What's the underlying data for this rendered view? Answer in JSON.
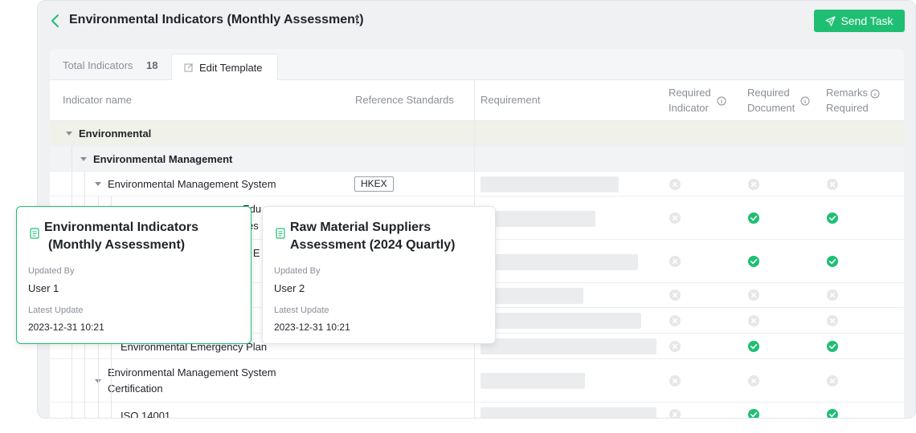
{
  "header": {
    "title": "Environmental Indicators (Monthly Assessment)",
    "send_label": "Send Task"
  },
  "toolbar": {
    "total_label": "Total Indicators",
    "total_count": "18",
    "edit_label": "Edit Template"
  },
  "table": {
    "columns": {
      "name": "Indicator name",
      "standards": "Reference Standards",
      "requirement": "Requirement",
      "req_indicator_1": "Required",
      "req_indicator_2": "Indicator",
      "req_document_1": "Required",
      "req_document_2": "Document",
      "remarks_1": "Remarks",
      "remarks_2": "Required"
    },
    "rows": [
      {
        "name": "Environmental"
      },
      {
        "name": "Environmental Management"
      },
      {
        "name": "Environmental Management System",
        "standard": "HKEX"
      },
      {
        "name": "Environmental Emergency Plan"
      },
      {
        "name_1": "Environmental Management System",
        "name_2": "Certification"
      },
      {
        "name": "ISO 14001"
      }
    ],
    "partial": {
      "row4_fragment_1": "Edu",
      "row4_fragment_2": "es",
      "row5_fragment": "e E"
    }
  },
  "cards": [
    {
      "title_1": "Environmental Indicators",
      "title_2": "(Monthly Assessment)",
      "updated_by_label": "Updated By",
      "updated_by": "User 1",
      "latest_update_label": "Latest Update",
      "latest_update": "2023-12-31 10:21"
    },
    {
      "title_1": "Raw Material Suppliers",
      "title_2": "Assessment (2024 Quartly)",
      "updated_by_label": "Updated By",
      "updated_by": "User 2",
      "latest_update_label": "Latest Update",
      "latest_update": "2023-12-31 10:21"
    }
  ],
  "colors": {
    "accent": "#1fbf73",
    "status_off": "#e6e7e9"
  },
  "icons": {
    "back": "chevron-left-icon",
    "more": "more-vertical-icon",
    "send": "paper-plane-icon",
    "edit": "edit-icon",
    "info": "info-icon",
    "check": "check-circle-icon",
    "cross": "x-circle-icon",
    "doc": "document-icon"
  }
}
